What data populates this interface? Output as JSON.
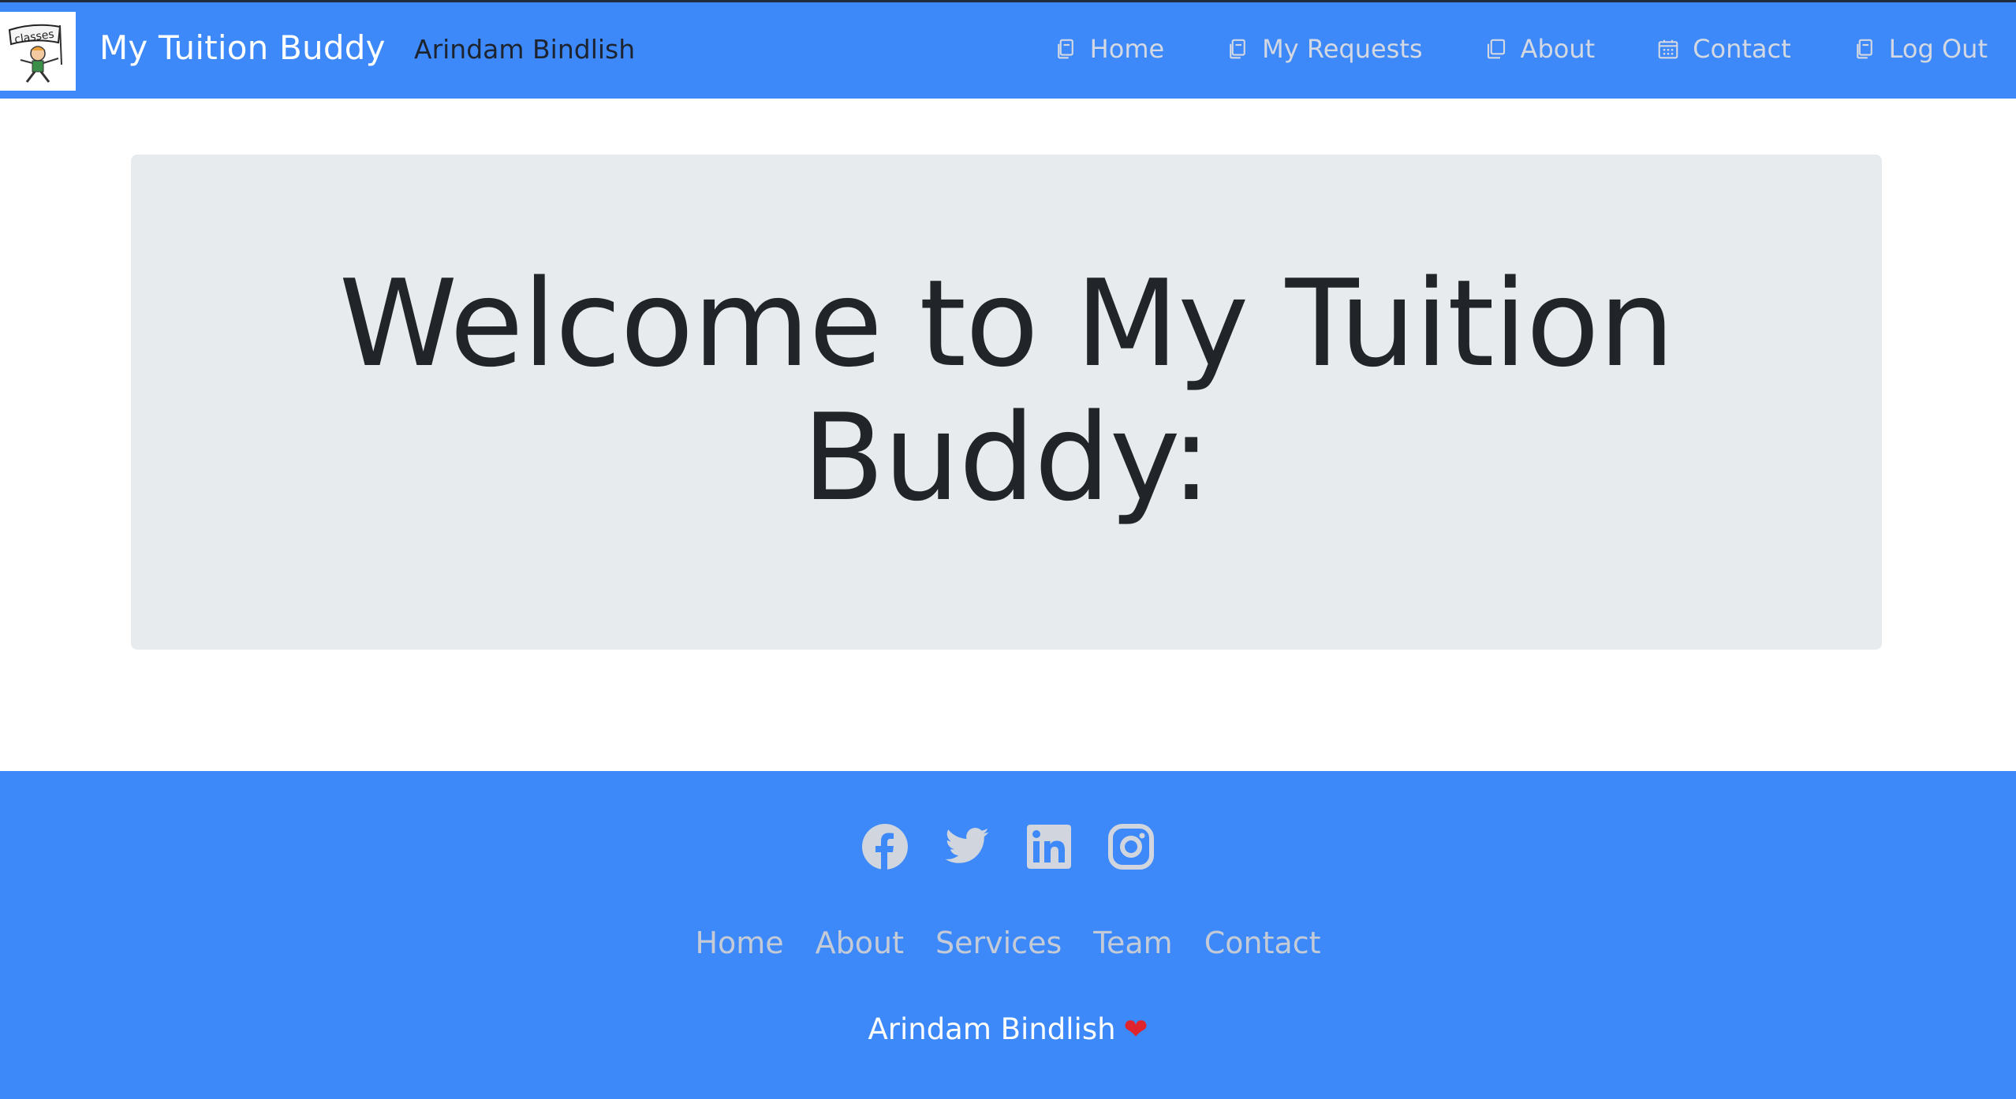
{
  "navbar": {
    "logo_icon": "classes-logo-icon",
    "brand": "My Tuition Buddy",
    "user_name": "Arindam Bindlish",
    "links": [
      {
        "label": "Home",
        "icon": "copy-icon"
      },
      {
        "label": "My Requests",
        "icon": "copy-icon"
      },
      {
        "label": "About",
        "icon": "copy-icon"
      },
      {
        "label": "Contact",
        "icon": "calendar-icon"
      },
      {
        "label": "Log Out",
        "icon": "copy-icon"
      }
    ]
  },
  "hero": {
    "title": "Welcome to My Tuition Buddy:"
  },
  "footer": {
    "social": [
      {
        "name": "facebook",
        "icon": "facebook-icon"
      },
      {
        "name": "twitter",
        "icon": "twitter-icon"
      },
      {
        "name": "linkedin",
        "icon": "linkedin-icon"
      },
      {
        "name": "instagram",
        "icon": "instagram-icon"
      }
    ],
    "links": [
      "Home",
      "About",
      "Services",
      "Team",
      "Contact"
    ],
    "credit": "Arindam Bindlish",
    "credit_icon": "heart-icon"
  },
  "colors": {
    "primary": "#3d89f9",
    "jumbotron_bg": "#e8ebee",
    "nav_link": "#d3d8e2",
    "footer_link": "#c4cbd7",
    "heading": "#212529"
  }
}
